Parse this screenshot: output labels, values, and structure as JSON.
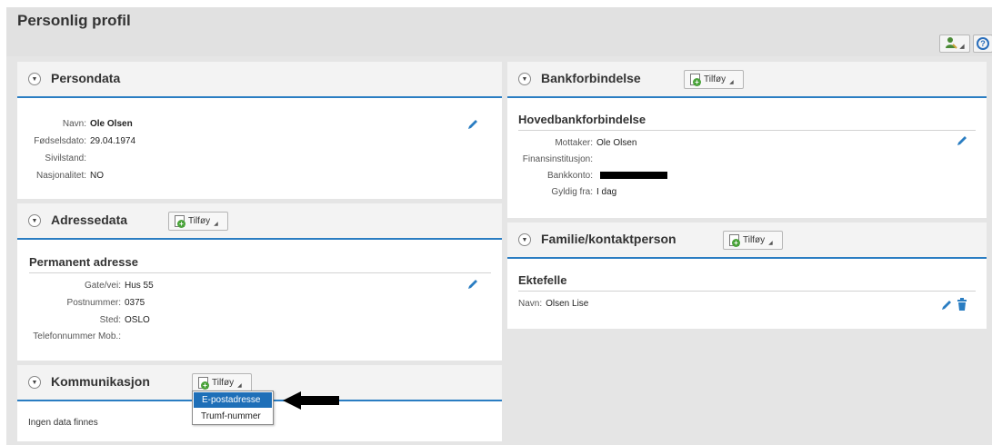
{
  "page": {
    "title": "Personlig profil"
  },
  "header_buttons": {
    "person_icon": "person-settings-icon",
    "help_icon": "help-icon",
    "help_glyph": "?"
  },
  "persondata": {
    "title": "Persondata",
    "rows": [
      {
        "label": "Navn:",
        "value": "Ole Olsen"
      },
      {
        "label": "Fødselsdato:",
        "value": "29.04.1974"
      },
      {
        "label": "Sivilstand:",
        "value": ""
      },
      {
        "label": "Nasjonalitet:",
        "value": "NO"
      }
    ]
  },
  "adressedata": {
    "title": "Adressedata",
    "add_label": "Tilføy",
    "subsection": "Permanent adresse",
    "rows": [
      {
        "label": "Gate/vei:",
        "value": "Hus 55"
      },
      {
        "label": "Postnummer:",
        "value": "0375"
      },
      {
        "label": "Sted:",
        "value": "OSLO"
      },
      {
        "label": "Telefonnummer Mob.:",
        "value": ""
      }
    ]
  },
  "kommunikasjon": {
    "title": "Kommunikasjon",
    "add_label": "Tilføy",
    "empty_text": "Ingen data finnes",
    "menu_items": [
      "E-postadresse",
      "Trumf-nummer"
    ]
  },
  "bankforbindelse": {
    "title": "Bankforbindelse",
    "add_label": "Tilføy",
    "subsection": "Hovedbankforbindelse",
    "rows": [
      {
        "label": "Mottaker:",
        "value": "Ole Olsen"
      },
      {
        "label": "Finansinstitusjon:",
        "value": ""
      },
      {
        "label": "Bankkonto:",
        "value": ""
      },
      {
        "label": "Gyldig fra:",
        "value": "I dag"
      }
    ]
  },
  "familie": {
    "title": "Familie/kontaktperson",
    "add_label": "Tilføy",
    "subsection": "Ektefelle",
    "rows": [
      {
        "label": "Navn:",
        "value": "Olsen Lise"
      }
    ]
  },
  "colors": {
    "accent": "#2a7dc2",
    "menu_selected": "#1e6fb8",
    "header_bg": "#e1e1e1"
  }
}
